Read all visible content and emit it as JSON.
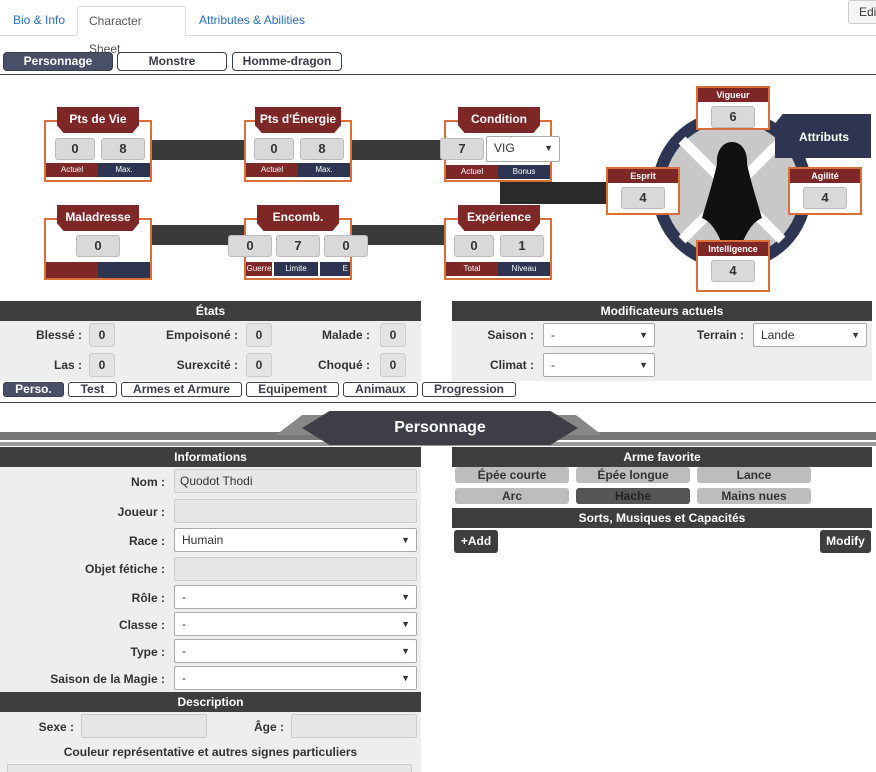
{
  "tabs": [
    "Bio & Info",
    "Character Sheet",
    "Attributes & Abilities"
  ],
  "edit_label": "Edi",
  "sheet_types": [
    "Personnage",
    "Monstre",
    "Homme-dragon"
  ],
  "stats": {
    "pv": {
      "title": "Pts de Vie",
      "actuel": "0",
      "max": "8",
      "sub_actuel": "Actuel",
      "sub_max": "Max."
    },
    "pe": {
      "title": "Pts d'Énergie",
      "actuel": "0",
      "max": "8",
      "sub_actuel": "Actuel",
      "sub_max": "Max."
    },
    "condition": {
      "title": "Condition",
      "actuel": "7",
      "bonus_select": "VIG",
      "sub_actuel": "Actuel",
      "sub_bonus": "Bonus"
    },
    "maladresse": {
      "title": "Maladresse",
      "value": "0"
    },
    "encomb": {
      "title": "Encomb.",
      "guerre": "0",
      "limite": "7",
      "third": "0",
      "sub_guerre": "Guerre",
      "sub_limite": "Limite",
      "sub_third": "E"
    },
    "experience": {
      "title": "Expérience",
      "total": "0",
      "niveau": "1",
      "sub_total": "Total",
      "sub_niveau": "Niveau"
    }
  },
  "attributes": {
    "title": "Attributs",
    "vigueur": {
      "label": "Vigueur",
      "value": "6"
    },
    "esprit": {
      "label": "Esprit",
      "value": "4"
    },
    "agilite": {
      "label": "Agilité",
      "value": "4"
    },
    "intelligence": {
      "label": "Intelligence",
      "value": "4"
    }
  },
  "etats": {
    "title": "États",
    "items": [
      {
        "label": "Blessé :",
        "value": "0"
      },
      {
        "label": "Empoisoné :",
        "value": "0"
      },
      {
        "label": "Malade :",
        "value": "0"
      },
      {
        "label": "Las :",
        "value": "0"
      },
      {
        "label": "Surexcité :",
        "value": "0"
      },
      {
        "label": "Choqué :",
        "value": "0"
      }
    ]
  },
  "modificateurs": {
    "title": "Modificateurs actuels",
    "saison_label": "Saison :",
    "saison_value": "-",
    "terrain_label": "Terrain :",
    "terrain_value": "Lande",
    "climat_label": "Climat :",
    "climat_value": "-"
  },
  "subtabs": [
    "Perso.",
    "Test",
    "Armes et Armure",
    "Equipement",
    "Animaux",
    "Progression"
  ],
  "banner": "Personnage",
  "informations": {
    "title": "Informations",
    "nom_label": "Nom :",
    "nom_value": "Quodot Thodi",
    "joueur_label": "Joueur :",
    "joueur_value": "",
    "race_label": "Race :",
    "race_value": "Humain",
    "fetiche_label": "Objet fétiche :",
    "fetiche_value": "",
    "role_label": "Rôle :",
    "role_value": "-",
    "classe_label": "Classe :",
    "classe_value": "-",
    "type_label": "Type :",
    "type_value": "-",
    "saison_magie_label": "Saison de la Magie :",
    "saison_magie_value": "-"
  },
  "description": {
    "title": "Description",
    "sexe_label": "Sexe :",
    "age_label": "Âge :",
    "couleur_label": "Couleur représentative et autres signes particuliers"
  },
  "arme_favorite": {
    "title": "Arme favorite",
    "weapons": [
      "Épée courte",
      "Épée longue",
      "Lance",
      "Arc",
      "Hache",
      "Mains nues"
    ],
    "selected": "Hache"
  },
  "sorts": {
    "title": "Sorts, Musiques et Capacités",
    "add_label": "+Add",
    "modify_label": "Modify"
  }
}
